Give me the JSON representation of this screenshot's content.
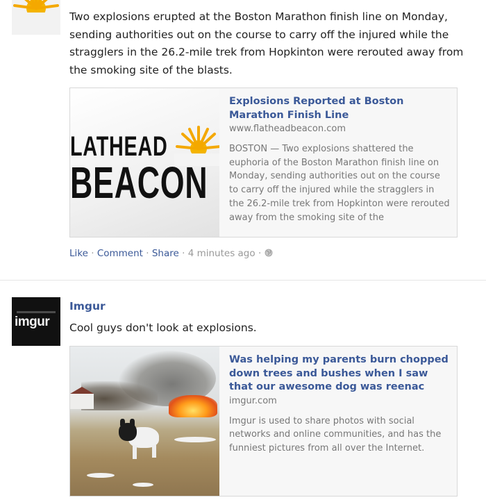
{
  "post1": {
    "message": "Two explosions erupted at the Boston Marathon finish line on Monday, sending authorities out on the course to carry off the injured while the stragglers in the 26.2-mile trek from Hopkinton were rerouted away from the smoking site of the blasts.",
    "card": {
      "logo_line1": "LATHEAD",
      "logo_line2": "BEACON",
      "title": "Explosions Reported at Boston Marathon Finish Line",
      "domain": "www.flatheadbeacon.com",
      "description": "BOSTON — Two explosions shattered the euphoria of the Boston Marathon finish line on Monday, sending authorities out on the course to carry off the injured while the stragglers in the 26.2-mile trek from Hopkinton were rerouted away from the smoking site of the"
    },
    "actions": {
      "like": "Like",
      "comment": "Comment",
      "share": "Share",
      "time": "4 minutes ago",
      "separator": "·"
    }
  },
  "post2": {
    "author": "Imgur",
    "avatar_text": "imgur",
    "message": "Cool guys don't look at explosions.",
    "card": {
      "title": "Was helping my parents burn chopped down trees and bushes when I saw that our awesome dog was reenac",
      "domain": "imgur.com",
      "description": "Imgur is used to share photos with social networks and online communities, and has the funniest pictures from all over the Internet."
    }
  },
  "icons": {
    "globe": "globe-icon",
    "sun": "sun-logo-icon"
  },
  "colors": {
    "link": "#3b5998",
    "meta": "#999999",
    "card_bg": "#f7f7f7"
  }
}
